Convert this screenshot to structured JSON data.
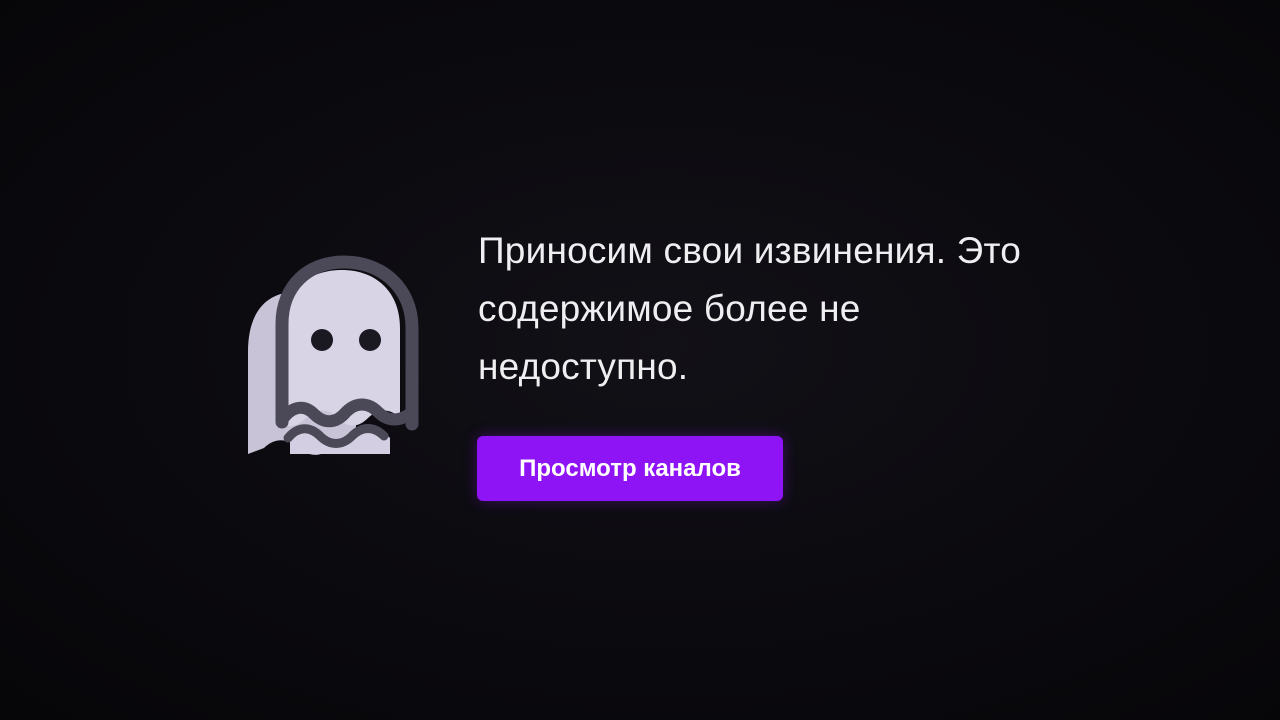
{
  "error_page": {
    "message": "Приносим свои извинения. Это\nсодержимое более не\nнедоступно.",
    "button_label": "Просмотр каналов",
    "illustration_icon": "ghost-icon"
  },
  "colors": {
    "background": "#0b0a0e",
    "text": "#efeff1",
    "button": "#8e13f5",
    "button_text": "#ffffff",
    "ghost_fill": "#d6d0e4",
    "ghost_outline": "#4a4856"
  }
}
